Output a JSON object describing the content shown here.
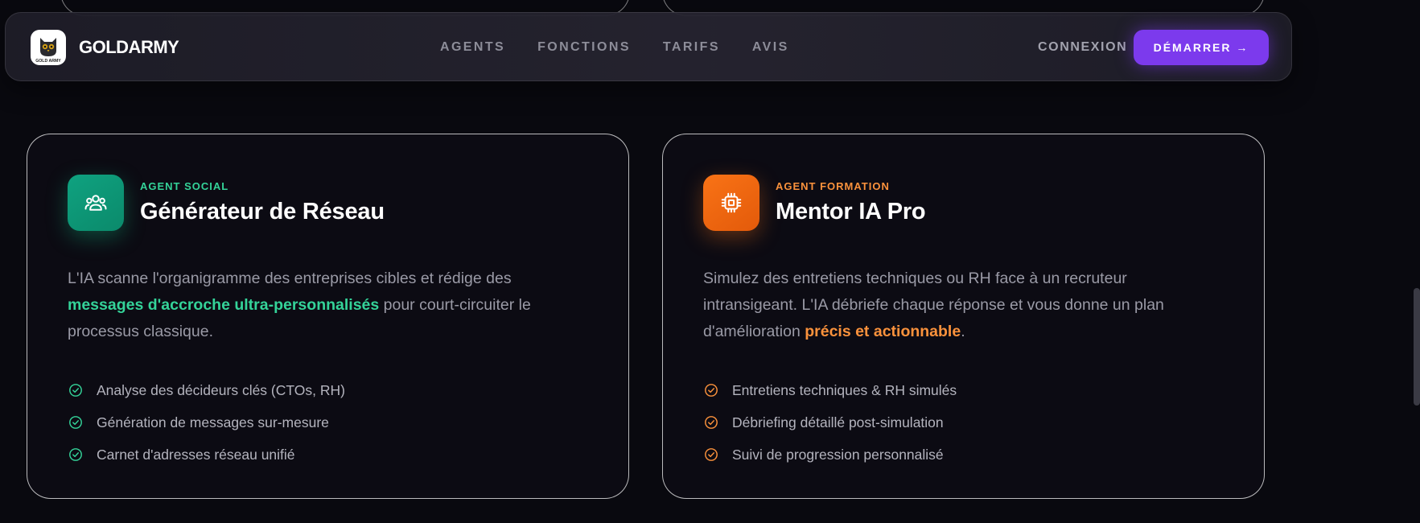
{
  "nav": {
    "brand": "GOLDARMY",
    "logo_text": "GOLD ARMY",
    "links": [
      "AGENTS",
      "FONCTIONS",
      "TARIFS",
      "AVIS"
    ],
    "login": "CONNEXION",
    "cta": "DÉMARRER →"
  },
  "cards": [
    {
      "kicker": "AGENT SOCIAL",
      "title": "Générateur de Réseau",
      "icon": "users-icon",
      "accent": "#34d399",
      "desc_before": "L'IA scanne l'organigramme des entreprises cibles et rédige des ",
      "desc_highlight": "messages d'accroche ultra-personnalisés",
      "desc_after": " pour court-circuiter le processus classique.",
      "features": [
        "Analyse des décideurs clés (CTOs, RH)",
        "Génération de messages sur-mesure",
        "Carnet d'adresses réseau unifié"
      ]
    },
    {
      "kicker": "AGENT FORMATION",
      "title": "Mentor IA Pro",
      "icon": "cpu-chip-icon",
      "accent": "#fb923c",
      "desc_before": "Simulez des entretiens techniques ou RH face à un recruteur intransigeant. L'IA débriefe chaque réponse et vous donne un plan d'amélioration ",
      "desc_highlight": "précis et actionnable",
      "desc_after": ".",
      "features": [
        "Entretiens techniques & RH simulés",
        "Débriefing détaillé post-simulation",
        "Suivi de progression personnalisé"
      ]
    }
  ],
  "colors": {
    "background": "#09090f",
    "primary": "#7c3aed",
    "teal": "#34d399",
    "orange": "#fb923c"
  }
}
